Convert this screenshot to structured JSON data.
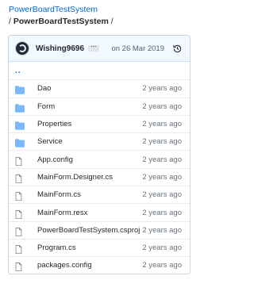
{
  "repo": {
    "link_text": "PowerBoardTestSystem"
  },
  "breadcrumb": {
    "prefix": "/",
    "current": "PowerBoardTestSystem",
    "suffix": "/"
  },
  "commit": {
    "author": "Wishing9696",
    "ellipsis": "···",
    "date": "on 26 Mar 2019"
  },
  "files": {
    "updir": "..",
    "items": [
      {
        "name": "Dao",
        "type": "folder",
        "age": "2 years ago"
      },
      {
        "name": "Form",
        "type": "folder",
        "age": "2 years ago"
      },
      {
        "name": "Properties",
        "type": "folder",
        "age": "2 years ago"
      },
      {
        "name": "Service",
        "type": "folder",
        "age": "2 years ago"
      },
      {
        "name": "App.config",
        "type": "file",
        "age": "2 years ago"
      },
      {
        "name": "MainForm.Designer.cs",
        "type": "file",
        "age": "2 years ago"
      },
      {
        "name": "MainForm.cs",
        "type": "file",
        "age": "2 years ago"
      },
      {
        "name": "MainForm.resx",
        "type": "file",
        "age": "2 years ago"
      },
      {
        "name": "PowerBoardTestSystem.csproj",
        "type": "file",
        "age": "2 years ago"
      },
      {
        "name": "Program.cs",
        "type": "file",
        "age": "2 years ago"
      },
      {
        "name": "packages.config",
        "type": "file",
        "age": "2 years ago"
      }
    ]
  },
  "colors": {
    "link": "#0366d6",
    "folder": "#79b8ff",
    "file_icon": "#6a737d",
    "commit_bg": "#f1f8ff"
  }
}
